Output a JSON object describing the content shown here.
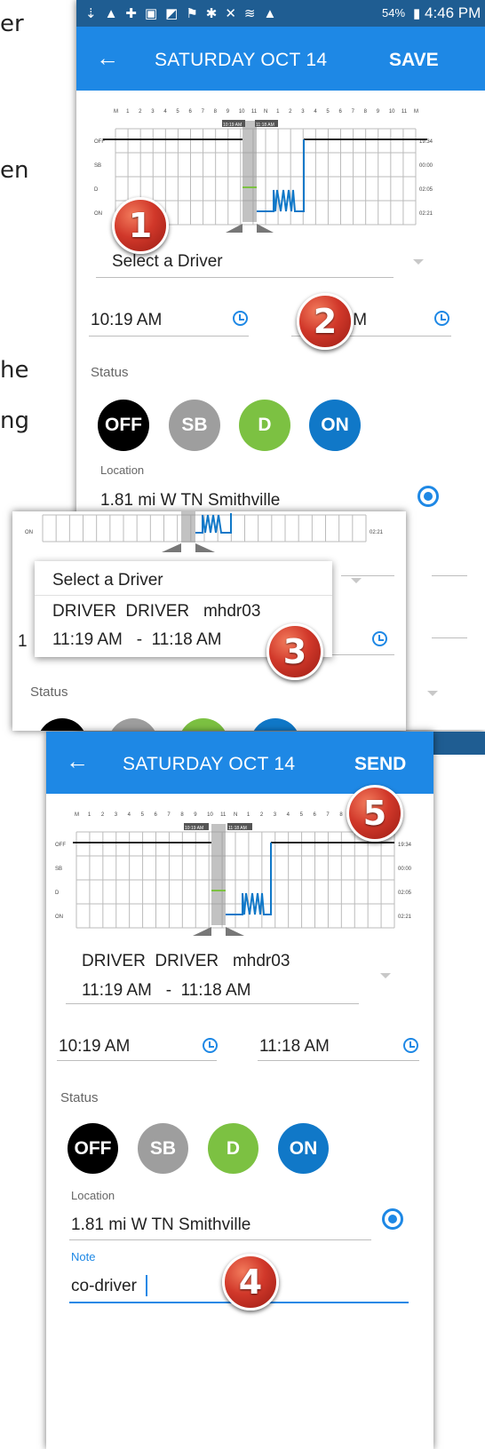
{
  "left_text": [
    "er",
    "en",
    "he",
    "ng"
  ],
  "status_bar": {
    "battery": "54%",
    "time": "4:46 PM",
    "time_partial": "M"
  },
  "screen1": {
    "back_icon": "arrow-left-icon",
    "title": "SATURDAY OCT 14",
    "action": "SAVE"
  },
  "screen2": {
    "back_icon": "arrow-left-icon",
    "title": "SATURDAY OCT 14",
    "action": "SEND"
  },
  "graph": {
    "hour_labels": [
      "M",
      "1",
      "2",
      "3",
      "4",
      "5",
      "6",
      "7",
      "8",
      "9",
      "10",
      "11",
      "N",
      "1",
      "2",
      "3",
      "4",
      "5",
      "6",
      "7",
      "8",
      "9",
      "10",
      "11",
      "M"
    ],
    "row_labels": [
      "OFF",
      "SB",
      "D",
      "ON"
    ],
    "totals": [
      "19:34",
      "00:00",
      "02:05",
      "02:21"
    ],
    "start_tag_1": "10:19 AM",
    "end_tag_1": "11:18 AM",
    "start_tag_2": "10:19 AM",
    "end_tag_2": "11:18 AM"
  },
  "driver_select": {
    "placeholder": "Select a Driver",
    "option_name": "DRIVER  DRIVER   mhdr03",
    "option_range": "11:19 AM   -  11:18 AM"
  },
  "times": {
    "start": "10:19 AM",
    "end": "11:18 AM",
    "end_partial": ".M",
    "popup_partial": "1"
  },
  "status": {
    "label": "Status",
    "off": "OFF",
    "sb": "SB",
    "d": "D",
    "on": "ON"
  },
  "location": {
    "label": "Location",
    "value": "1.81 mi W TN Smithville"
  },
  "note": {
    "label": "Note",
    "value": "co-driver"
  },
  "badges": [
    "1",
    "2",
    "3",
    "4",
    "5"
  ],
  "colors": {
    "appbar": "#1e88e5",
    "status_bar": "#1f5d92",
    "off": "#000000",
    "sb": "#9e9e9e",
    "d": "#7cc142",
    "on": "#1078c8",
    "badge": "#d1382a"
  }
}
